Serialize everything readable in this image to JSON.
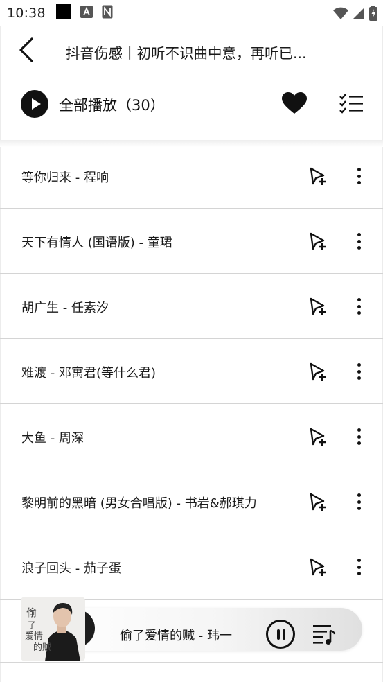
{
  "status_bar": {
    "time": "10:38",
    "icons": [
      "notification-square-icon",
      "app-a-icon",
      "app-n-icon",
      "wifi-icon",
      "signal-icon",
      "battery-icon"
    ]
  },
  "header": {
    "title": "抖音伤感丨初听不识曲中意，再听已..."
  },
  "play_all": {
    "label": "全部播放（30）"
  },
  "songs": [
    {
      "label": "等你归来 - 程响"
    },
    {
      "label": "天下有情人 (国语版) - 童珺"
    },
    {
      "label": "胡广生 - 任素汐"
    },
    {
      "label": "难渡 - 邓寓君(等什么君)"
    },
    {
      "label": "大鱼 - 周深"
    },
    {
      "label": "黎明前的黑暗 (男女合唱版) - 书岩&郝琪力"
    },
    {
      "label": "浪子回头 - 茄子蛋"
    }
  ],
  "player": {
    "now_playing": "偷了爱情的贼 - 玮一",
    "album_art_text": "偷了爱情的贼"
  },
  "colors": {
    "text": "#1a1a1a",
    "divider": "#d4d4d4",
    "icon": "#111111"
  }
}
